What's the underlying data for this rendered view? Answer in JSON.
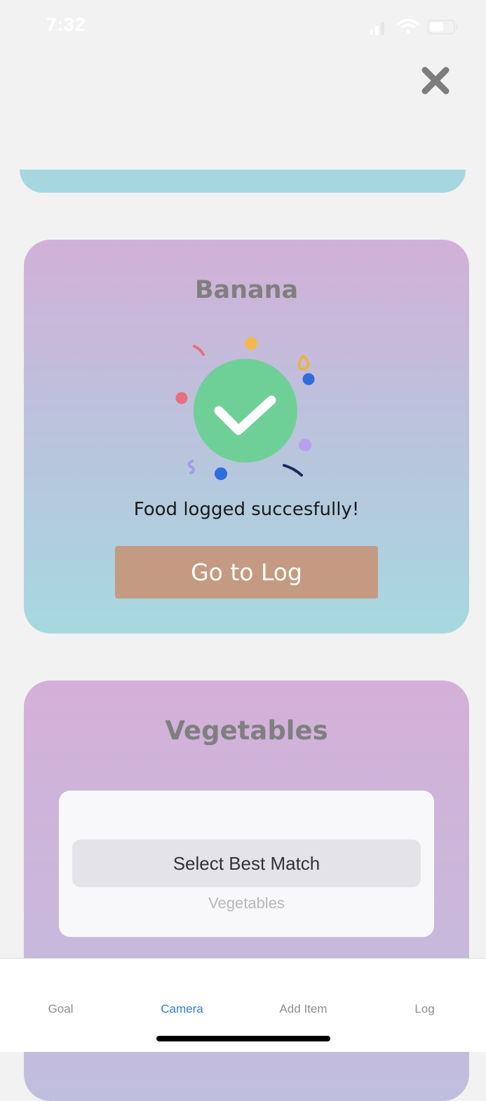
{
  "status_bar": {
    "time": "7:32",
    "icons": [
      "signal-icon",
      "wifi-icon",
      "battery-icon"
    ]
  },
  "header": {
    "close_icon": "close-icon"
  },
  "banana_card": {
    "title": "Banana",
    "icon": "checkmark-success-icon",
    "message": "Food logged succesfully!",
    "button_label": "Go to Log",
    "button_color": "#c49b82",
    "check_color": "#6fd097"
  },
  "vegetables_card": {
    "title": "Vegetables",
    "picker": {
      "selected": "Select Best Match",
      "options": [
        "Vegetables"
      ]
    }
  },
  "tab_bar": {
    "active_color": "#2f7de1",
    "tabs": [
      {
        "label": "Goal"
      },
      {
        "label": "Camera",
        "active": true
      },
      {
        "label": "Add Item"
      },
      {
        "label": "Log"
      }
    ]
  }
}
